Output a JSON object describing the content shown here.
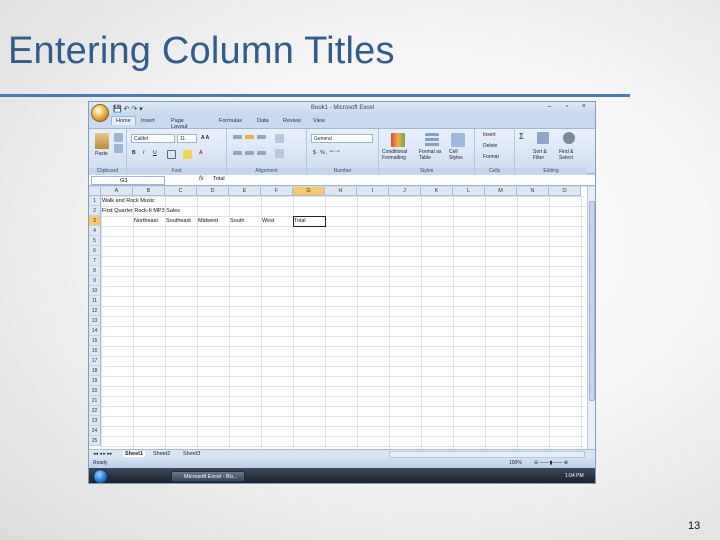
{
  "slide": {
    "title": "Entering Column Titles",
    "number": "13"
  },
  "window": {
    "title": "Book1 - Microsoft Excel",
    "controls": "–  ▫  ×"
  },
  "ribbon_tabs": [
    "Home",
    "Insert",
    "Page Layout",
    "Formulas",
    "Data",
    "Review",
    "View"
  ],
  "ribbon": {
    "clipboard": {
      "paste": "Paste",
      "label": "Clipboard"
    },
    "font": {
      "name": "Calibri",
      "size": "11",
      "label": "Font"
    },
    "alignment": {
      "label": "Alignment"
    },
    "number": {
      "format": "General",
      "label": "Number"
    },
    "styles": {
      "conditional": "Conditional Formatting",
      "format_table": "Format as Table",
      "cell_styles": "Cell Styles",
      "label": "Styles"
    },
    "cells": {
      "insert": "Insert",
      "delete": "Delete",
      "format": "Format",
      "label": "Cells"
    },
    "editing": {
      "sort": "Sort & Filter",
      "find": "Find & Select",
      "label": "Editing"
    }
  },
  "formula_bar": {
    "name_box": "G3",
    "fx": "fx",
    "content": "Total"
  },
  "columns": [
    "A",
    "B",
    "C",
    "D",
    "E",
    "F",
    "G",
    "H",
    "I",
    "J",
    "K",
    "L",
    "M",
    "N",
    "O"
  ],
  "rows": [
    "1",
    "2",
    "3",
    "4",
    "5",
    "6",
    "7",
    "8",
    "9",
    "10",
    "11",
    "12",
    "13",
    "14",
    "15",
    "16",
    "17",
    "18",
    "19",
    "20",
    "21",
    "22",
    "23",
    "24",
    "25"
  ],
  "selected": {
    "col": "G",
    "row": "3"
  },
  "cells": [
    {
      "col": 0,
      "row": 0,
      "text": "Walk and Rock Music"
    },
    {
      "col": 0,
      "row": 1,
      "text": "First Quarter Rock-It MP3 Sales"
    },
    {
      "col": 1,
      "row": 2,
      "text": "Northeast"
    },
    {
      "col": 2,
      "row": 2,
      "text": "Southeast"
    },
    {
      "col": 3,
      "row": 2,
      "text": "Midwest"
    },
    {
      "col": 4,
      "row": 2,
      "text": "South"
    },
    {
      "col": 5,
      "row": 2,
      "text": "West"
    },
    {
      "col": 6,
      "row": 2,
      "text": "Total"
    }
  ],
  "sheets": [
    "Sheet1",
    "Sheet2",
    "Sheet3"
  ],
  "status": {
    "ready": "Ready",
    "zoom": "100%"
  },
  "taskbar": {
    "app": "Microsoft Excel - Bo...",
    "time": "1:04 PM"
  },
  "colors": {
    "title": "#2f5d8e",
    "accent": "#4a7ab8",
    "selected_header": "#f7c96b"
  }
}
